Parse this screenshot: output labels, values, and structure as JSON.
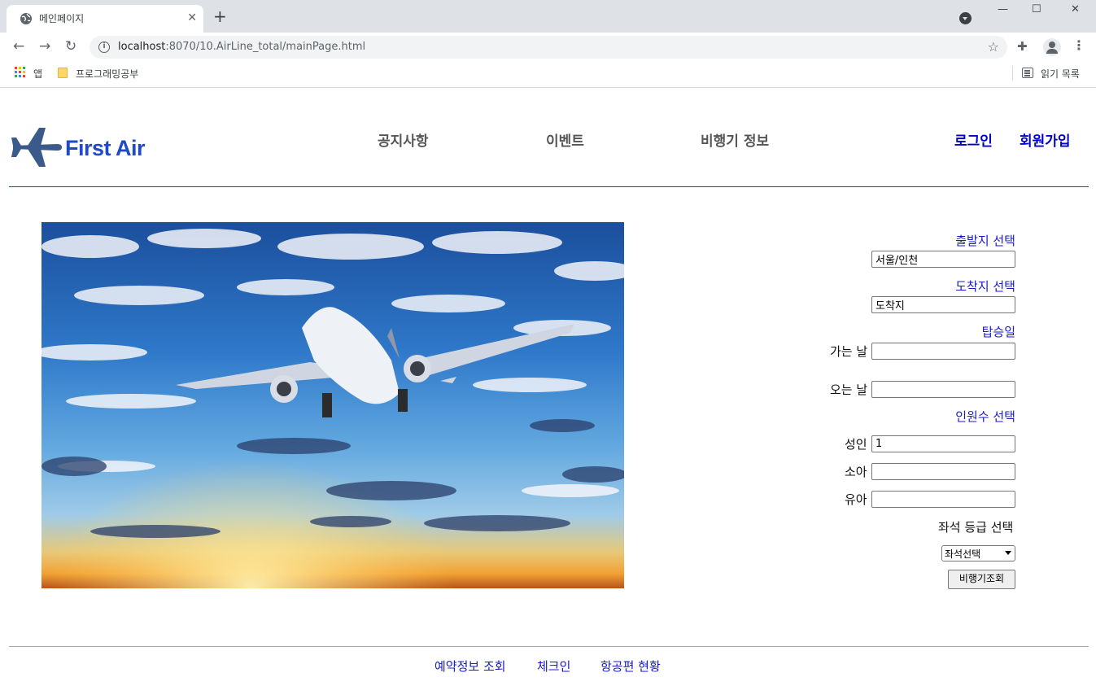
{
  "browser": {
    "tab_title": "메인페이지",
    "tab_close": "✕",
    "new_tab": "+",
    "url_host": "localhost",
    "url_rest": ":8070/10.AirLine_total/mainPage.html",
    "bookmarks": [
      {
        "label": "앱"
      },
      {
        "label": "프로그래밍공부"
      }
    ],
    "reading_list": "읽기 목록",
    "window_controls": {
      "minimize": "—",
      "maximize": "☐",
      "close": "✕"
    }
  },
  "header": {
    "logo_text": "First Air",
    "nav": [
      "공지사항",
      "이벤트",
      "비행기 정보"
    ],
    "login": "로그인",
    "signup": "회원가입"
  },
  "form": {
    "departure_label": "출발지 선택",
    "departure_value": "서울/인천",
    "arrival_label": "도착지 선택",
    "arrival_value": "도착지",
    "boarding_label": "탑승일",
    "depart_date_label": "가는 날",
    "depart_date_value": "",
    "return_date_label": "오는 날",
    "return_date_value": "",
    "passengers_label": "인원수 선택",
    "adult_label": "성인",
    "adult_value": "1",
    "child_label": "소아",
    "child_value": "",
    "infant_label": "유아",
    "infant_value": "",
    "seat_class_label": "좌석 등급 선택",
    "seat_class_selected": "좌석선택",
    "search_button": "비행기조회"
  },
  "footer": {
    "links": [
      "예약정보 조회",
      "체크인",
      "항공편 현황"
    ]
  },
  "colors": {
    "link_blue": "#1a1acc",
    "logo_blue": "#1f49c8",
    "nav_grey": "#555555",
    "divider_teal": "#1e5a5a"
  }
}
